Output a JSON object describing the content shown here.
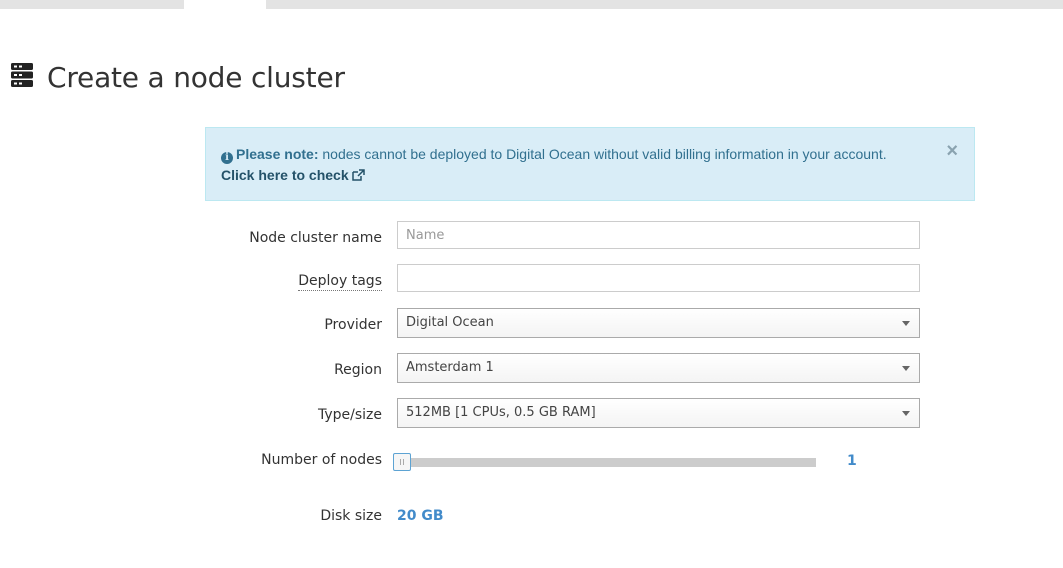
{
  "page": {
    "title": "Create a node cluster",
    "title_icon": "server-icon"
  },
  "alert": {
    "icon": "info-circle-icon",
    "strong": "Please note:",
    "message": " nodes cannot be deployed to Digital Ocean without valid billing information in your account.",
    "link_text": "Click here to check",
    "link_icon": "external-link-icon",
    "close": "×"
  },
  "form": {
    "name": {
      "label": "Node cluster name",
      "value": "",
      "placeholder": "Name"
    },
    "tags": {
      "label": "Deploy tags",
      "value": ""
    },
    "provider": {
      "label": "Provider",
      "selected": "Digital Ocean"
    },
    "region": {
      "label": "Region",
      "selected": "Amsterdam 1"
    },
    "size": {
      "label": "Type/size",
      "selected": "512MB [1 CPUs, 0.5 GB RAM]"
    },
    "nodes": {
      "label": "Number of nodes",
      "value": "1",
      "fraction": 0
    },
    "disk": {
      "label": "Disk size",
      "value": "20 GB"
    }
  },
  "colors": {
    "alert_bg": "#d9edf7",
    "alert_text": "#31708f",
    "accent": "#428bca"
  }
}
